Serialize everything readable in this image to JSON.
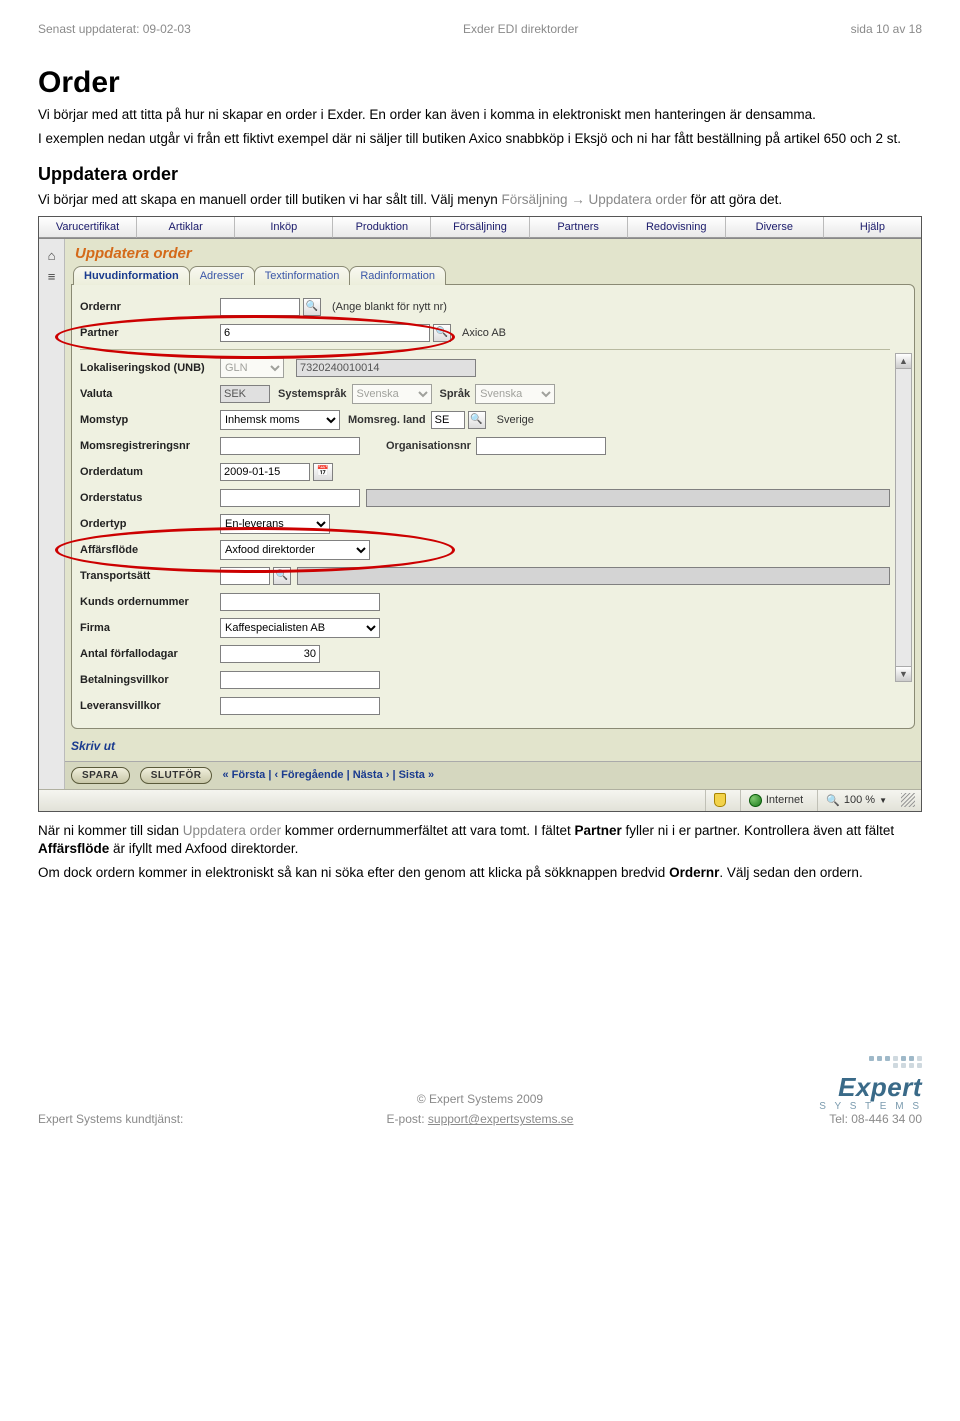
{
  "header": {
    "left": "Senast uppdaterat: 09-02-03",
    "center": "Exder EDI direktorder",
    "right": "sida 10 av 18"
  },
  "doc": {
    "h1": "Order",
    "p1": "Vi börjar med att titta på hur ni skapar en order i Exder. En order kan även i komma in elektroniskt men hanteringen är densamma.",
    "p2": "I exemplen nedan utgår vi från ett fiktivt exempel där ni säljer till butiken Axico snabbköp i Eksjö och ni har fått beställning på artikel 650 och 2 st.",
    "h2": "Uppdatera order",
    "p3a": "Vi börjar med att skapa en manuell order till butiken vi har sålt till. Välj menyn ",
    "p3_menu1": "Försäljning",
    "p3_arrow": " → ",
    "p3_menu2": "Uppdatera order",
    "p3b": " för att göra det."
  },
  "menubar": [
    "Varucertifikat",
    "Artiklar",
    "Inköp",
    "Produktion",
    "Försäljning",
    "Partners",
    "Redovisning",
    "Diverse",
    "Hjälp"
  ],
  "app": {
    "title": "Uppdatera order",
    "tabs": [
      "Huvudinformation",
      "Adresser",
      "Textinformation",
      "Radinformation"
    ],
    "fields": {
      "ordernr_label": "Ordernr",
      "ordernr_hint": "(Ange blankt för nytt nr)",
      "partner_label": "Partner",
      "partner_value": "6",
      "partner_name": "Axico AB",
      "unb_label": "Lokaliseringskod (UNB)",
      "unb_sel": "GLN",
      "unb_val": "7320240010014",
      "valuta_label": "Valuta",
      "valuta_val": "SEK",
      "syssprak_label": "Systemspråk",
      "syssprak_val": "Svenska",
      "sprak_label": "Språk",
      "sprak_val": "Svenska",
      "momstyp_label": "Momstyp",
      "momstyp_val": "Inhemsk moms",
      "momsland_label": "Momsreg. land",
      "momsland_val": "SE",
      "momsland_name": "Sverige",
      "momsreg_label": "Momsregistreringsnr",
      "orgnr_label": "Organisationsnr",
      "orderdatum_label": "Orderdatum",
      "orderdatum_val": "2009-01-15",
      "orderstatus_label": "Orderstatus",
      "ordertyp_label": "Ordertyp",
      "ordertyp_val": "En-leverans",
      "affarsflode_label": "Affärsflöde",
      "affarsflode_val": "Axfood direktorder",
      "transport_label": "Transportsätt",
      "kundsorder_label": "Kunds ordernummer",
      "firma_label": "Firma",
      "firma_val": "Kaffespecialisten AB",
      "forfallo_label": "Antal förfallodagar",
      "forfallo_val": "30",
      "betvillkor_label": "Betalningsvillkor",
      "levvillkor_label": "Leveransvillkor"
    },
    "footer_link": "Skriv ut",
    "btn_spara": "SPARA",
    "btn_slutfor": "SLUTFÖR",
    "nav": "« Första  |  ‹ Föregående  |  Nästa ›  |  Sista »",
    "status_internet": "Internet",
    "status_zoom": "100 %"
  },
  "after": {
    "p1a": "När ni kommer till sidan ",
    "p1_link": "Uppdatera order",
    "p1b": " kommer ordernummerfältet att vara tomt. I fältet ",
    "p1_bold1": "Partner",
    "p1c": " fyller ni i er partner. Kontrollera även att fältet ",
    "p1_bold2": "Affärsflöde",
    "p1d": " är ifyllt med Axfood direktorder.",
    "p2a": "Om dock ordern kommer in elektroniskt så kan ni söka efter den genom att klicka på sökknappen bredvid ",
    "p2_bold": "Ordernr",
    "p2b": ". Välj sedan den ordern."
  },
  "pagefoot": {
    "copyright": "© Expert Systems 2009",
    "left": "Expert Systems kundtjänst:",
    "center_label": "E-post: ",
    "center_link": "support@expertsystems.se",
    "right": "Tel: 08-446 34 00",
    "logo_word": "Expert",
    "logo_sub": "S Y S T E M S"
  }
}
